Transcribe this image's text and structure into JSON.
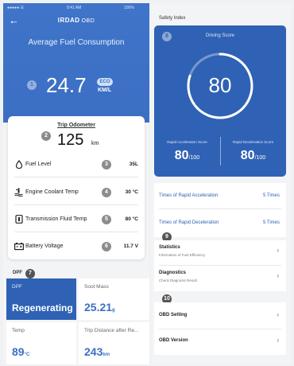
{
  "status": {
    "carrier": "●●●●● ☰",
    "time": "9:41 AM",
    "battery": "100%"
  },
  "nav": {
    "brand": "IRDAD",
    "brand_suffix": "OBD"
  },
  "fuel": {
    "title": "Average Fuel Consumption",
    "badge": "1",
    "value": "24.7",
    "eco": "ECO",
    "unit": "KM/L"
  },
  "odometer": {
    "title": "Trip Odometer",
    "badge": "2",
    "value": "125",
    "unit": "km"
  },
  "metrics": [
    {
      "label": "Fuel Level",
      "badge": "3",
      "value": "35L",
      "icon": "droplet-icon"
    },
    {
      "label": "Engine Coolant Temp",
      "badge": "4",
      "value": "30 °C",
      "icon": "thermometer-icon"
    },
    {
      "label": "Transmission Fluid Temp",
      "badge": "5",
      "value": "80 °C",
      "icon": "transmission-icon"
    },
    {
      "label": "Battery Voltage",
      "badge": "6",
      "value": "11.7 V",
      "icon": "battery-icon"
    }
  ],
  "dpf": {
    "label": "DPF",
    "badge": "7",
    "tiles": [
      {
        "label": "DPF",
        "value": "Regenerating",
        "unit": ""
      },
      {
        "label": "Soot Mass",
        "value": "25.21",
        "unit": "g"
      },
      {
        "label": "Temp",
        "value": "89",
        "unit": "°C"
      },
      {
        "label": "Trip Distance after Re...",
        "value": "243",
        "unit": "km"
      }
    ]
  },
  "safety": {
    "title": "Safety Index",
    "badge": "8",
    "score_title": "Driving Score",
    "score": 80,
    "score_text": "80",
    "acc_label": "Rapid Acceleration Score",
    "acc_value": "80",
    "dec_label": "Rapid Deceleration Score",
    "dec_value": "80",
    "out_of": "/100"
  },
  "times": [
    {
      "label": "Times of Rapid Acceleration",
      "value": "5 Times"
    },
    {
      "label": "Times of Rapid Deceleration",
      "value": "5 Times"
    }
  ],
  "menu1": {
    "badge": "9",
    "items": [
      {
        "label": "Statistics",
        "sub": "Information of Fuel Efficiency"
      },
      {
        "label": "Diagnostics",
        "sub": "Check Diagnosis Result"
      }
    ]
  },
  "menu2": {
    "badge": "10",
    "items": [
      {
        "label": "OBD Setting"
      },
      {
        "label": "OBD Version"
      }
    ]
  },
  "colors": {
    "primary": "#3c6fc4",
    "primary_dark": "#2f62b4"
  }
}
